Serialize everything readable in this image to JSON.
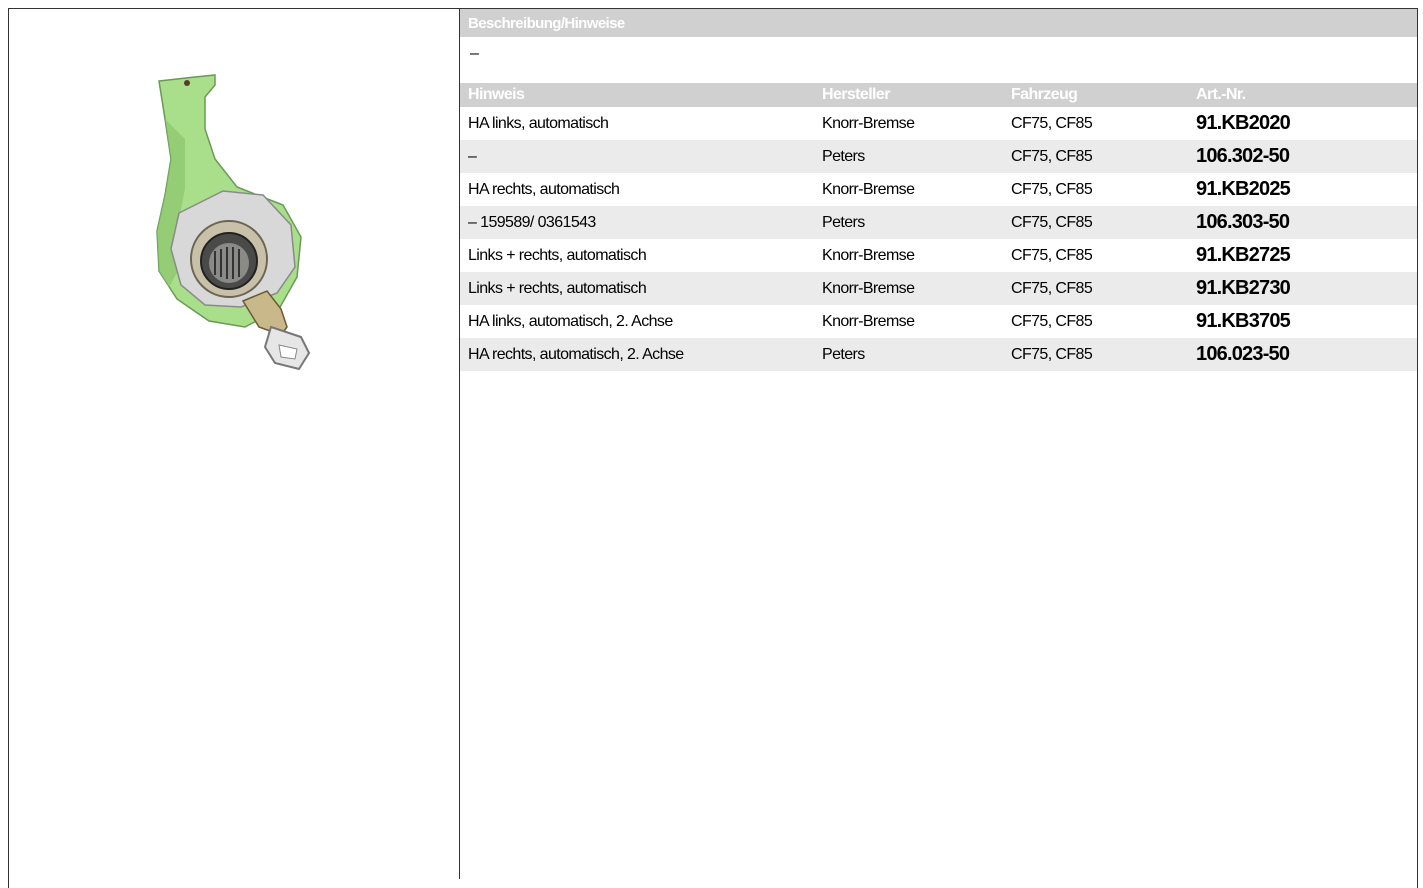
{
  "description": {
    "header": "Beschreibung/Hinweise",
    "text": "–"
  },
  "table": {
    "columns": [
      "Hinweis",
      "Hersteller",
      "Fahrzeug",
      "Art.-Nr."
    ],
    "rows": [
      {
        "hinweis": "HA links, automatisch",
        "hersteller": "Knorr-Bremse",
        "fahrzeug": "CF75, CF85",
        "art_nr": "91.KB2020"
      },
      {
        "hinweis": "–",
        "hersteller": "Peters",
        "fahrzeug": "CF75, CF85",
        "art_nr": "106.302-50"
      },
      {
        "hinweis": "HA rechts, automatisch",
        "hersteller": "Knorr-Bremse",
        "fahrzeug": "CF75, CF85",
        "art_nr": "91.KB2025"
      },
      {
        "hinweis": "– 159589/ 0361543",
        "hersteller": "Peters",
        "fahrzeug": "CF75, CF85",
        "art_nr": "106.303-50"
      },
      {
        "hinweis": "Links + rechts, automatisch",
        "hersteller": "Knorr-Bremse",
        "fahrzeug": "CF75, CF85",
        "art_nr": "91.KB2725"
      },
      {
        "hinweis": "Links + rechts, automatisch",
        "hersteller": "Knorr-Bremse",
        "fahrzeug": "CF75, CF85",
        "art_nr": "91.KB2730"
      },
      {
        "hinweis": "HA links, automatisch, 2. Achse",
        "hersteller": "Knorr-Bremse",
        "fahrzeug": "CF75, CF85",
        "art_nr": "91.KB3705"
      },
      {
        "hinweis": "HA rechts, automatisch, 2. Achse",
        "hersteller": "Peters",
        "fahrzeug": "CF75, CF85",
        "art_nr": "106.023-50"
      }
    ]
  },
  "colors": {
    "header_bg": "#d0d0d0",
    "row_alt_bg": "#ebebeb",
    "part_green": "#a9df8a"
  }
}
